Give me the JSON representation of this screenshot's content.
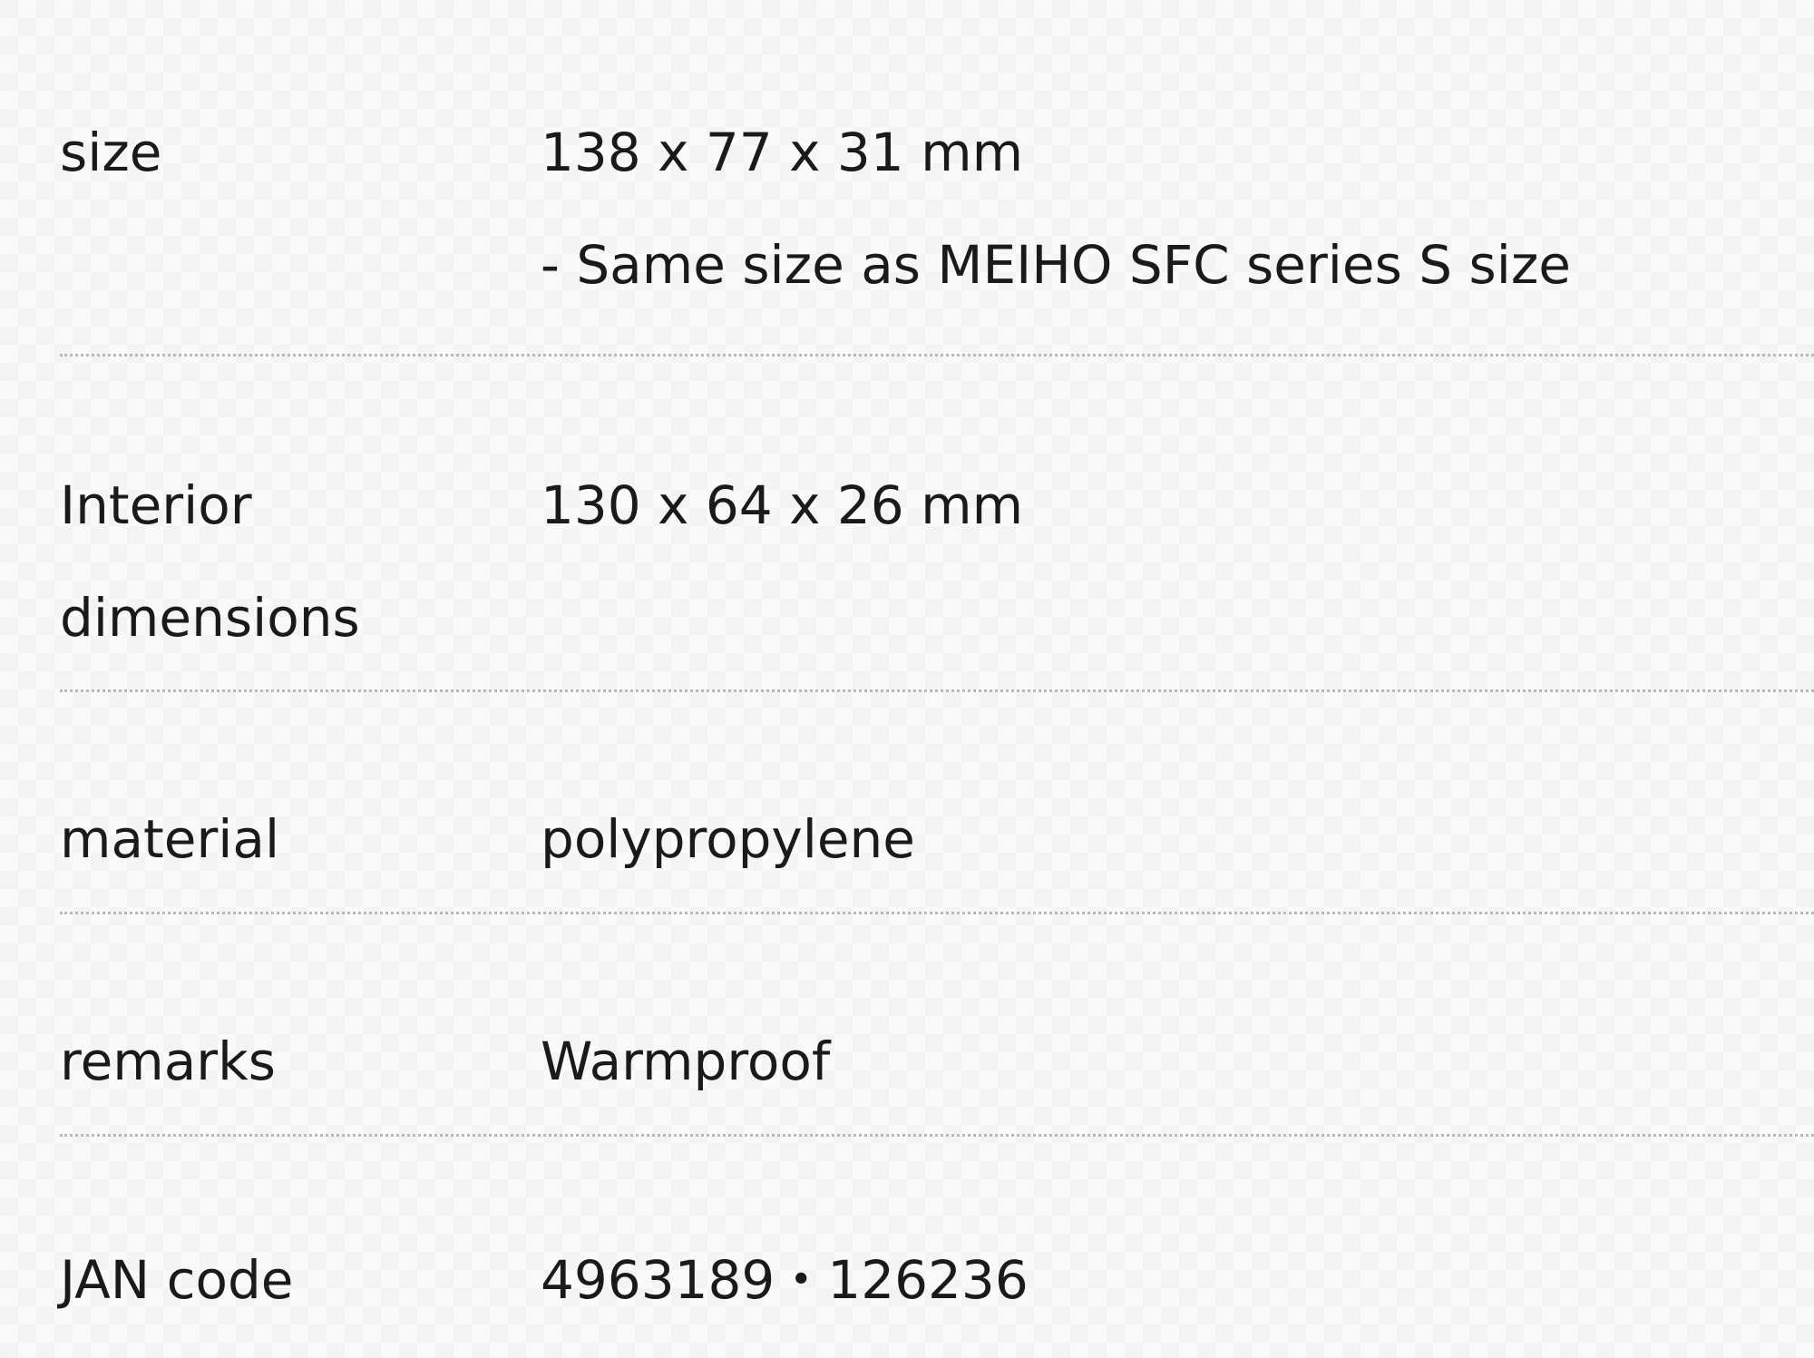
{
  "specs": [
    {
      "label": "size",
      "value_lines": [
        "138 x 77 x 31 mm",
        "- Same size as MEIHO SFC series S size"
      ]
    },
    {
      "label": "Interior dimensions",
      "value_lines": [
        "130 x 64 x 26 mm"
      ]
    },
    {
      "label": "material",
      "value_lines": [
        "polypropylene"
      ]
    },
    {
      "label": "remarks",
      "value_lines": [
        "Warmproof"
      ]
    },
    {
      "label": "JAN code",
      "value_lines": [
        "4963189・126236"
      ]
    }
  ]
}
